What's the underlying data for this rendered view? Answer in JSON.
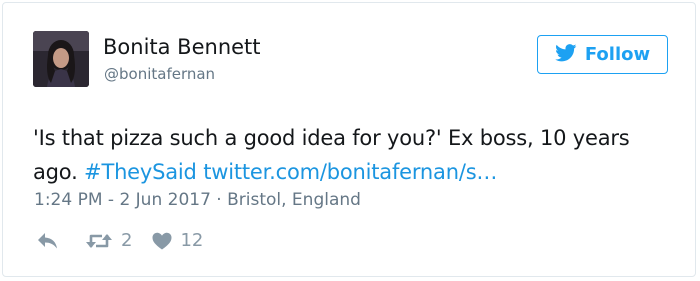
{
  "tweet": {
    "author": {
      "display_name": "Bonita Bennett",
      "username": "@bonitafernan"
    },
    "follow_label": "Follow",
    "text_plain": "'Is that pizza such a good idea for you?' Ex boss, 10 years ago.",
    "hashtag": "#TheySaid",
    "link": "twitter.com/bonitafernan/s…",
    "meta": "1:24 PM - 2 Jun 2017 · Bristol, England",
    "retweet_count": "2",
    "like_count": "12"
  },
  "colors": {
    "accent": "#1da1f2",
    "link": "#1b95e0",
    "muted": "#657786"
  },
  "icons": [
    "twitter-bird-icon",
    "reply-icon",
    "retweet-icon",
    "heart-icon"
  ]
}
